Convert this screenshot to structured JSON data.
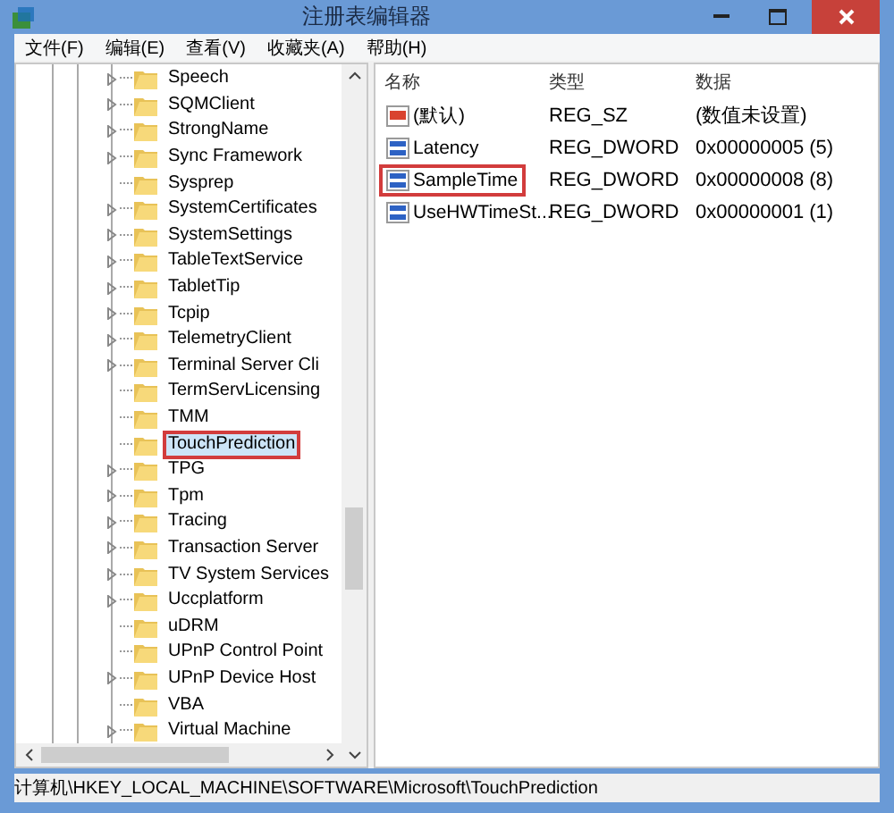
{
  "window": {
    "title": "注册表编辑器"
  },
  "menu": [
    "文件(F)",
    "编辑(E)",
    "查看(V)",
    "收藏夹(A)",
    "帮助(H)"
  ],
  "tree": {
    "items": [
      {
        "label": "Speech",
        "expandable": true,
        "selected": false,
        "marked": false
      },
      {
        "label": "SQMClient",
        "expandable": true,
        "selected": false,
        "marked": false
      },
      {
        "label": "StrongName",
        "expandable": true,
        "selected": false,
        "marked": false
      },
      {
        "label": "Sync Framework",
        "expandable": true,
        "selected": false,
        "marked": false
      },
      {
        "label": "Sysprep",
        "expandable": false,
        "selected": false,
        "marked": false
      },
      {
        "label": "SystemCertificates",
        "expandable": true,
        "selected": false,
        "marked": false
      },
      {
        "label": "SystemSettings",
        "expandable": true,
        "selected": false,
        "marked": false
      },
      {
        "label": "TableTextService",
        "expandable": true,
        "selected": false,
        "marked": false
      },
      {
        "label": "TabletTip",
        "expandable": true,
        "selected": false,
        "marked": false
      },
      {
        "label": "Tcpip",
        "expandable": true,
        "selected": false,
        "marked": false
      },
      {
        "label": "TelemetryClient",
        "expandable": true,
        "selected": false,
        "marked": false
      },
      {
        "label": "Terminal Server Cli",
        "expandable": true,
        "selected": false,
        "marked": false
      },
      {
        "label": "TermServLicensing",
        "expandable": false,
        "selected": false,
        "marked": false
      },
      {
        "label": "TMM",
        "expandable": false,
        "selected": false,
        "marked": false
      },
      {
        "label": "TouchPrediction",
        "expandable": false,
        "selected": true,
        "marked": true
      },
      {
        "label": "TPG",
        "expandable": true,
        "selected": false,
        "marked": false
      },
      {
        "label": "Tpm",
        "expandable": true,
        "selected": false,
        "marked": false
      },
      {
        "label": "Tracing",
        "expandable": true,
        "selected": false,
        "marked": false
      },
      {
        "label": "Transaction Server",
        "expandable": true,
        "selected": false,
        "marked": false
      },
      {
        "label": "TV System Services",
        "expandable": true,
        "selected": false,
        "marked": false
      },
      {
        "label": "Uccplatform",
        "expandable": true,
        "selected": false,
        "marked": false
      },
      {
        "label": "uDRM",
        "expandable": false,
        "selected": false,
        "marked": false
      },
      {
        "label": "UPnP Control Point",
        "expandable": false,
        "selected": false,
        "marked": false
      },
      {
        "label": "UPnP Device Host",
        "expandable": true,
        "selected": false,
        "marked": false
      },
      {
        "label": "VBA",
        "expandable": false,
        "selected": false,
        "marked": false
      },
      {
        "label": "Virtual Machine",
        "expandable": true,
        "selected": false,
        "marked": false
      }
    ]
  },
  "values": {
    "columns": [
      "名称",
      "类型",
      "数据"
    ],
    "rows": [
      {
        "kind": "string",
        "name": "(默认)",
        "type": "REG_SZ",
        "data": "(数值未设置)",
        "marked": false
      },
      {
        "kind": "number",
        "name": "Latency",
        "type": "REG_DWORD",
        "data": "0x00000005 (5)",
        "marked": false
      },
      {
        "kind": "number",
        "name": "SampleTime",
        "type": "REG_DWORD",
        "data": "0x00000008 (8)",
        "marked": true
      },
      {
        "kind": "number",
        "name": "UseHWTimeSt...",
        "type": "REG_DWORD",
        "data": "0x00000001 (1)",
        "marked": false
      }
    ]
  },
  "status_bar": "计算机\\HKEY_LOCAL_MACHINE\\SOFTWARE\\Microsoft\\TouchPrediction"
}
